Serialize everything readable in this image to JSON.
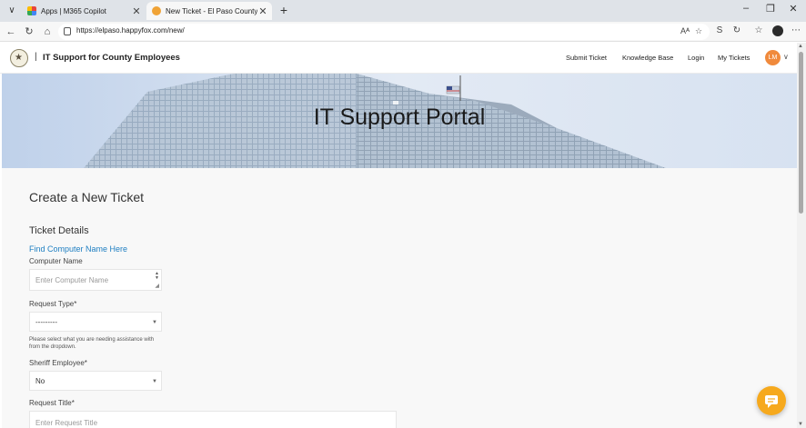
{
  "browser": {
    "tabs": [
      {
        "title": "Apps | M365 Copilot",
        "icon": "m365-icon"
      },
      {
        "title": "New Ticket - El Paso County - IT H",
        "icon": "happyfox-icon"
      }
    ],
    "url": "https://elpaso.happyfox.com/new/",
    "read_aloud": "Aᴬ",
    "s_label": "S"
  },
  "header": {
    "brand": "IT Support for County Employees",
    "separator": "|",
    "nav": [
      "Submit Ticket",
      "Knowledge Base",
      "Login",
      "My Tickets"
    ],
    "avatar_initials": "LM"
  },
  "hero": {
    "title": "IT Support Portal"
  },
  "form": {
    "page_title": "Create a New Ticket",
    "section_title": "Ticket Details",
    "computer_name_link": "Find Computer Name Here",
    "computer_name_label": "Computer Name",
    "computer_name_placeholder": "Enter Computer Name",
    "request_type_label": "Request Type*",
    "request_type_value": "---------",
    "request_type_help": "Please select what you are needing assistance with from the dropdown.",
    "sheriff_label": "Sheriff Employee*",
    "sheriff_value": "No",
    "request_title_label": "Request Title*",
    "request_title_placeholder": "Enter Request Title"
  },
  "colors": {
    "accent_link": "#1f7fc2",
    "avatar": "#f08a3c",
    "chat_button": "#f6a91d"
  }
}
